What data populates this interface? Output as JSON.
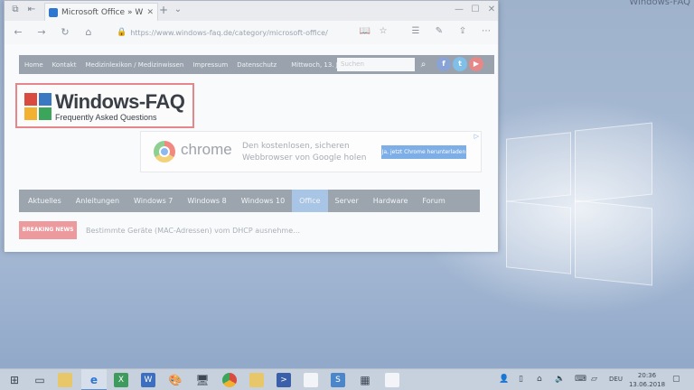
{
  "desktop": {
    "corner_brand": "Windows-FAQ"
  },
  "browser": {
    "tab": {
      "title": "Microsoft Office » Wind",
      "close": "✕"
    },
    "tab_new": "+",
    "tab_list": "⌄",
    "window_controls": {
      "minimize": "—",
      "maximize": "☐",
      "close": "✕"
    },
    "nav": {
      "back": "←",
      "forward": "→",
      "refresh": "↻",
      "home": "⌂"
    },
    "address": {
      "url": "https://www.windows-faq.de/category/microsoft-office/"
    }
  },
  "site": {
    "topnav_links": [
      "Home",
      "Kontakt",
      "Medizinlexikon / Medizinwissen",
      "Impressum",
      "Datenschutz"
    ],
    "date": "Mittwoch, 13. Juni 2018",
    "search_placeholder": "Suchen",
    "social": [
      "f",
      "t",
      "▶"
    ],
    "logo": {
      "title": "Windows-FAQ",
      "subtitle": "Frequently Asked Questions"
    },
    "ad": {
      "brand": "chrome",
      "text": "Den kostenlosen, sicheren Webbrowser von Google holen",
      "button": "Ja, jetzt Chrome herunterladen",
      "mark": "▷"
    },
    "mainnav": [
      "Aktuelles",
      "Anleitungen",
      "Windows 7",
      "Windows 8",
      "Windows 10",
      "Office",
      "Server",
      "Hardware",
      "Forum"
    ],
    "mainnav_active": "Office",
    "breaking_label": "BREAKING NEWS",
    "breaking_text": "Bestimmte Geräte (MAC-Adressen) vom DHCP ausnehme…"
  },
  "taskbar": {
    "language": "DEU",
    "time": "20:36",
    "date": "13.06.2018"
  },
  "colors": {
    "accent": "#5b8fd1",
    "logo_red": "#d84b3e",
    "logo_blue": "#3b78c2",
    "logo_yellow": "#f2b230",
    "logo_green": "#3ba55c"
  }
}
